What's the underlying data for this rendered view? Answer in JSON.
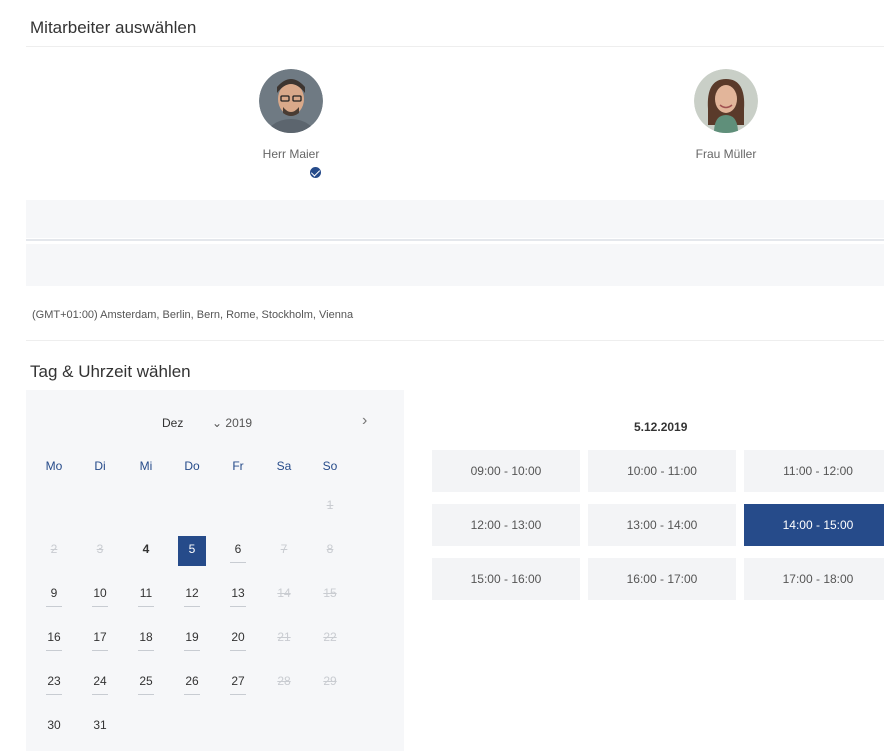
{
  "staff_section": {
    "title": "Mitarbeiter auswählen",
    "staff": [
      {
        "name": "Herr Maier",
        "selected": true
      },
      {
        "name": "Frau Müller",
        "selected": false
      }
    ]
  },
  "timezone": "(GMT+01:00) Amsterdam, Berlin, Bern, Rome, Stockholm, Vienna",
  "datetime_section": {
    "title": "Tag & Uhrzeit wählen"
  },
  "calendar": {
    "month": "Dez",
    "year": "2019",
    "weekdays": [
      "Mo",
      "Di",
      "Mi",
      "Do",
      "Fr",
      "Sa",
      "So"
    ],
    "selected_day": "5",
    "days": [
      "1",
      "2",
      "3",
      "4",
      "5",
      "6",
      "7",
      "8",
      "9",
      "10",
      "11",
      "12",
      "13",
      "14",
      "15",
      "16",
      "17",
      "18",
      "19",
      "20",
      "21",
      "22",
      "23",
      "24",
      "25",
      "26",
      "27",
      "28",
      "29",
      "30",
      "31"
    ]
  },
  "timeslots": {
    "date_label": "5.12.2019",
    "slots": [
      "09:00 - 10:00",
      "10:00 - 11:00",
      "11:00 - 12:00",
      "12:00 - 13:00",
      "13:00 - 14:00",
      "14:00 - 15:00",
      "15:00 - 16:00",
      "16:00 - 17:00",
      "17:00 - 18:00"
    ],
    "selected_slot": "14:00 - 15:00"
  },
  "colors": {
    "accent": "#264b8a",
    "panel_bg": "#f6f7f9",
    "slot_bg": "#f3f4f6"
  }
}
